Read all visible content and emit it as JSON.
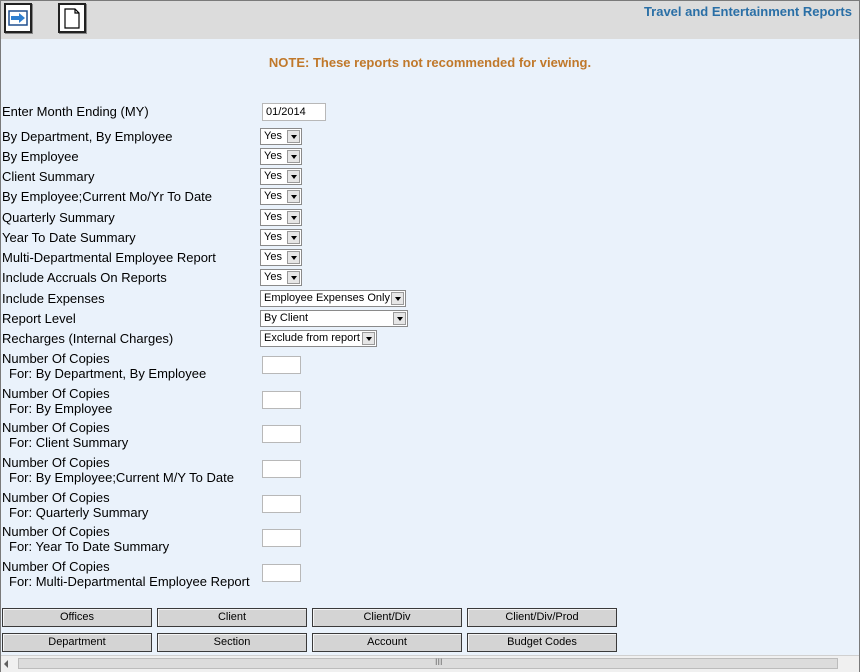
{
  "header": {
    "title": "Travel and Entertainment Reports"
  },
  "toolbar": {
    "submit_icon": "arrow-right-icon",
    "document_icon": "document-icon"
  },
  "note": "NOTE: These reports not recommended for viewing.",
  "month_ending": {
    "label": "Enter Month Ending (MY)",
    "value": "01/2014"
  },
  "options": [
    {
      "label": "By Department, By Employee",
      "value": "Yes"
    },
    {
      "label": "By Employee",
      "value": "Yes"
    },
    {
      "label": "Client Summary",
      "value": "Yes"
    },
    {
      "label": "By Employee;Current Mo/Yr To Date",
      "value": "Yes"
    },
    {
      "label": "Quarterly Summary",
      "value": "Yes"
    },
    {
      "label": "Year To Date Summary",
      "value": "Yes"
    },
    {
      "label": "Multi-Departmental Employee Report",
      "value": "Yes"
    },
    {
      "label": "Include Accruals On Reports",
      "value": "Yes"
    },
    {
      "label": "Include Expenses",
      "value": "Employee Expenses Only"
    },
    {
      "label": "Report Level",
      "value": "By Client"
    },
    {
      "label": "Recharges (Internal Charges)",
      "value": "Exclude from report"
    }
  ],
  "copies": [
    {
      "label": "Number Of Copies",
      "sub": "For: By Department, By Employee",
      "value": ""
    },
    {
      "label": "Number Of Copies",
      "sub": "For: By Employee",
      "value": ""
    },
    {
      "label": "Number Of Copies",
      "sub": "For: Client Summary",
      "value": ""
    },
    {
      "label": "Number Of Copies",
      "sub": "For: By Employee;Current M/Y To Date",
      "value": ""
    },
    {
      "label": "Number Of Copies",
      "sub": "For: Quarterly Summary",
      "value": ""
    },
    {
      "label": "Number Of Copies",
      "sub": "For: Year To Date Summary",
      "value": ""
    },
    {
      "label": "Number Of Copies",
      "sub": "For: Multi-Departmental Employee Report",
      "value": ""
    }
  ],
  "buttons": {
    "row1": [
      "Offices",
      "Client",
      "Client/Div",
      "Client/Div/Prod"
    ],
    "row2": [
      "Department",
      "Section",
      "Account",
      "Budget Codes"
    ]
  },
  "scrollbar": {
    "grip": "III"
  }
}
